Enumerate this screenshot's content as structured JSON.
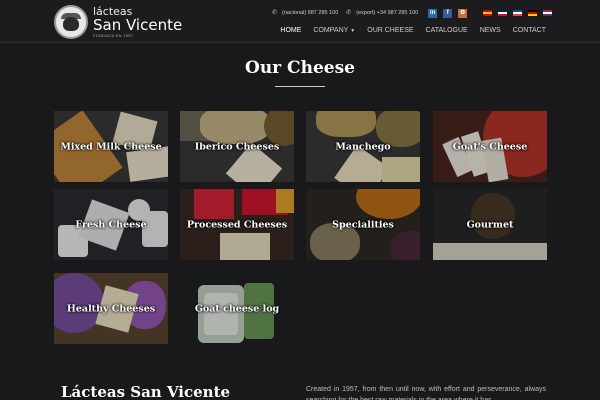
{
  "brand": {
    "line1": "lácteas",
    "line2": "San Vicente",
    "tagline": "FUNDADA EN 1957"
  },
  "contact": {
    "national": "(nacional) 987 285 100",
    "export": "(export) +34 987 285 100"
  },
  "social": [
    {
      "icon": "linkedin-icon",
      "glyph": "in"
    },
    {
      "icon": "facebook-icon",
      "glyph": "f"
    },
    {
      "icon": "other-social-icon",
      "glyph": "✿"
    }
  ],
  "flags": [
    {
      "icon": "flag-spain-icon",
      "colors": [
        "#c60b1e",
        "#ffc400",
        "#c60b1e"
      ]
    },
    {
      "icon": "flag-uk-icon",
      "colors": [
        "#012169",
        "#ffffff",
        "#c8102e"
      ]
    },
    {
      "icon": "flag-france-icon",
      "colors": [
        "#0055a4",
        "#ffffff",
        "#ef4135"
      ]
    },
    {
      "icon": "flag-germany-icon",
      "colors": [
        "#000000",
        "#dd0000",
        "#ffce00"
      ]
    },
    {
      "icon": "flag-usa-icon",
      "colors": [
        "#b22234",
        "#ffffff",
        "#3c3b6e"
      ]
    }
  ],
  "nav": {
    "home": "HOME",
    "company": "COMPANY",
    "our_cheese": "OUR CHEESE",
    "catalogue": "CATALOGUE",
    "news": "NEWS",
    "contact": "CONTACT"
  },
  "page_title": "Our Cheese",
  "tiles": [
    {
      "label": "Mixed Milk Cheese",
      "base": "#6b4a2a"
    },
    {
      "label": "Iberico Cheeses",
      "base": "#3a3328"
    },
    {
      "label": "Manchego",
      "base": "#4a4030"
    },
    {
      "label": "Goat's Cheese",
      "base": "#5a2c22"
    },
    {
      "label": "Fresh Cheese",
      "base": "#2c2d30"
    },
    {
      "label": "Processed Cheeses",
      "base": "#3a2a22"
    },
    {
      "label": "Specialities",
      "base": "#34302a"
    },
    {
      "label": "Gourmet",
      "base": "#2a2a2a"
    },
    {
      "label": "Healthy Cheeses",
      "base": "#4a3a50"
    },
    {
      "label": "Goat cheese log",
      "base": "#222426"
    }
  ],
  "about": {
    "title": "Lácteas San Vicente",
    "text": "Created in 1957, from then until now, with effort and perseverance, always searching for the best raw materials in the area where it has"
  }
}
